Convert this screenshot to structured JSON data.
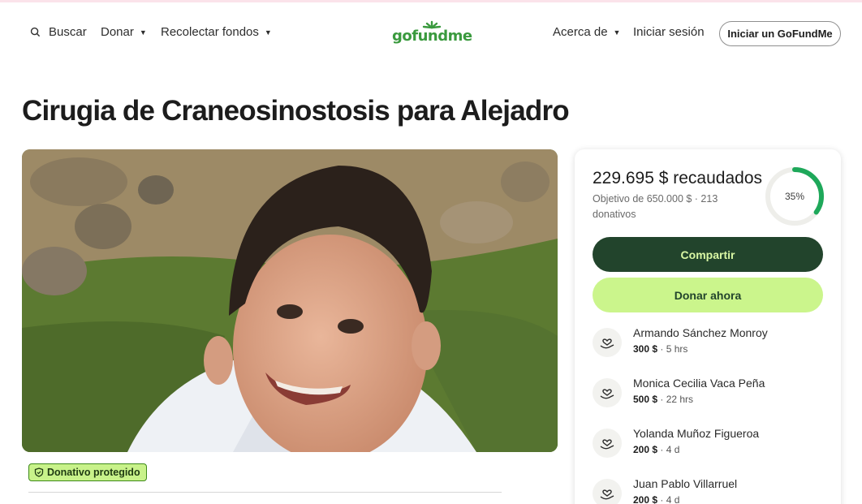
{
  "nav": {
    "search_label": "Buscar",
    "donate_label": "Donar",
    "fundraise_label": "Recolectar fondos",
    "logo_text": "gofundme",
    "about_label": "Acerca de",
    "login_label": "Iniciar sesión",
    "start_label": "Iniciar un GoFundMe"
  },
  "campaign": {
    "title": "Cirugia de Craneosinostosis para Alejadro",
    "protected_badge": "Donativo protegido"
  },
  "donation_card": {
    "raised_text": "229.695 $ recaudados",
    "goal_text": "Objetivo de 650.000 $ · 213 donativos",
    "progress_percent": 35,
    "progress_label": "35%",
    "share_label": "Compartir",
    "donate_label": "Donar ahora",
    "recent_donations": [
      {
        "name": "Armando Sánchez Monroy",
        "amount": "300 $",
        "time": " · 5 hrs"
      },
      {
        "name": "Monica Cecilia Vaca Peña",
        "amount": "500 $",
        "time": " · 22 hrs"
      },
      {
        "name": "Yolanda Muñoz Figueroa",
        "amount": "200 $",
        "time": " · 4 d"
      },
      {
        "name": "Juan Pablo Villarruel",
        "amount": "200 $",
        "time": " · 4 d"
      }
    ]
  },
  "colors": {
    "brand_green": "#3a9a3e",
    "dark_green": "#22442c",
    "lime": "#cbf58c"
  }
}
